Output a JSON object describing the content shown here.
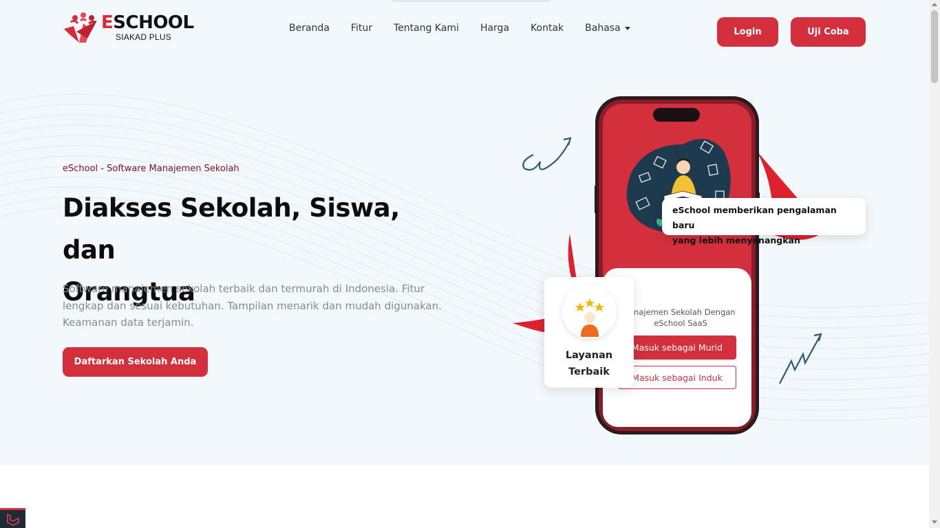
{
  "brand": {
    "name_first": "E",
    "name_rest": "SCHOOL",
    "subtitle": "SIAKAD PLUS",
    "color": "#d72b3a"
  },
  "nav": {
    "items": [
      {
        "label": "Beranda"
      },
      {
        "label": "Fitur"
      },
      {
        "label": "Tentang Kami"
      },
      {
        "label": "Harga"
      },
      {
        "label": "Kontak"
      }
    ],
    "language_label": "Bahasa"
  },
  "actions": {
    "login_label": "Login",
    "trial_label": "Uji Coba"
  },
  "hero": {
    "eyebrow": "eSchool - Software Manajemen Sekolah",
    "headline_line1": "Diakses Sekolah, Siswa, dan",
    "headline_line2": "Orangtua",
    "description": "Software manajemen sekolah terbaik dan termurah di Indonesia. Fitur lengkap dan sesuai kebutuhan. Tampilan menarik dan mudah digunakan. Keamanan data terjamin.",
    "cta_label": "Daftarkan Sekolah Anda"
  },
  "illustration": {
    "bubble_line1": "eSchool memberikan pengalaman baru",
    "bubble_line2": "yang lebih menyenangkan",
    "service_line1": "Layanan",
    "service_line2": "Terbaik",
    "phone_title_line1": "anajemen Sekolah Dengan",
    "phone_title_line2": "eSchool SaaS",
    "phone_btn_student": "Masuk sebagai Murid",
    "phone_btn_parent": "Masuk sebagai Induk"
  },
  "colors": {
    "accent": "#d32f3d",
    "hero_bg": "#f2f8fc",
    "ink_dark": "#0d0d0d",
    "doodle": "#2d5a7b"
  },
  "icons": [
    "logo-people-icon",
    "star-icon",
    "person-icon",
    "curly-arrow-icon",
    "zigzag-arrow-icon",
    "laravel-icon"
  ]
}
